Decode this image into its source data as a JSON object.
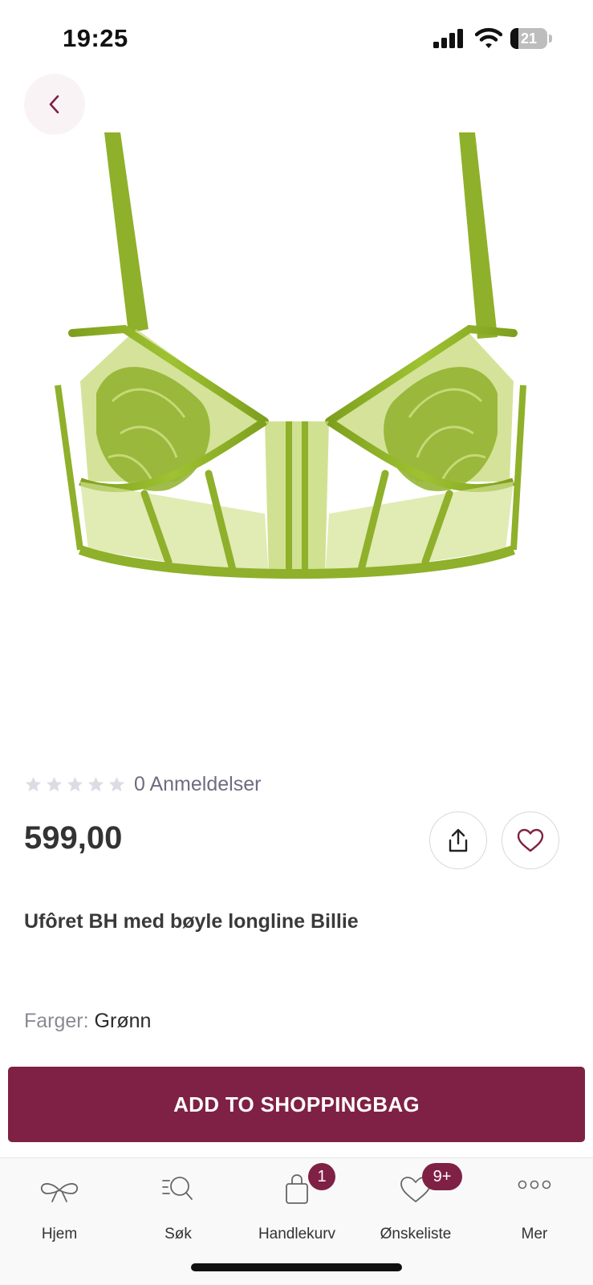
{
  "status_bar": {
    "time": "19:25",
    "battery_level": "21"
  },
  "product": {
    "reviews": "0 Anmeldelser",
    "rating": 0,
    "price": "599,00",
    "title": "Ufôret BH med bøyle longline Billie",
    "colors_label": "Farger:",
    "color_value": "Grønn"
  },
  "actions": {
    "add_to_bag": "ADD TO SHOPPINGBAG"
  },
  "tab_bar": {
    "home": "Hjem",
    "search": "Søk",
    "cart": "Handlekurv",
    "cart_badge": "1",
    "wishlist": "Ønskeliste",
    "wishlist_badge": "9+",
    "more": "Mer"
  },
  "colors": {
    "accent": "#7f2144",
    "product": "#8fb02a"
  },
  "icons": [
    "back-arrow-icon",
    "share-icon",
    "heart-icon",
    "bow-icon",
    "search-icon",
    "bag-icon",
    "more-dots-icon"
  ]
}
